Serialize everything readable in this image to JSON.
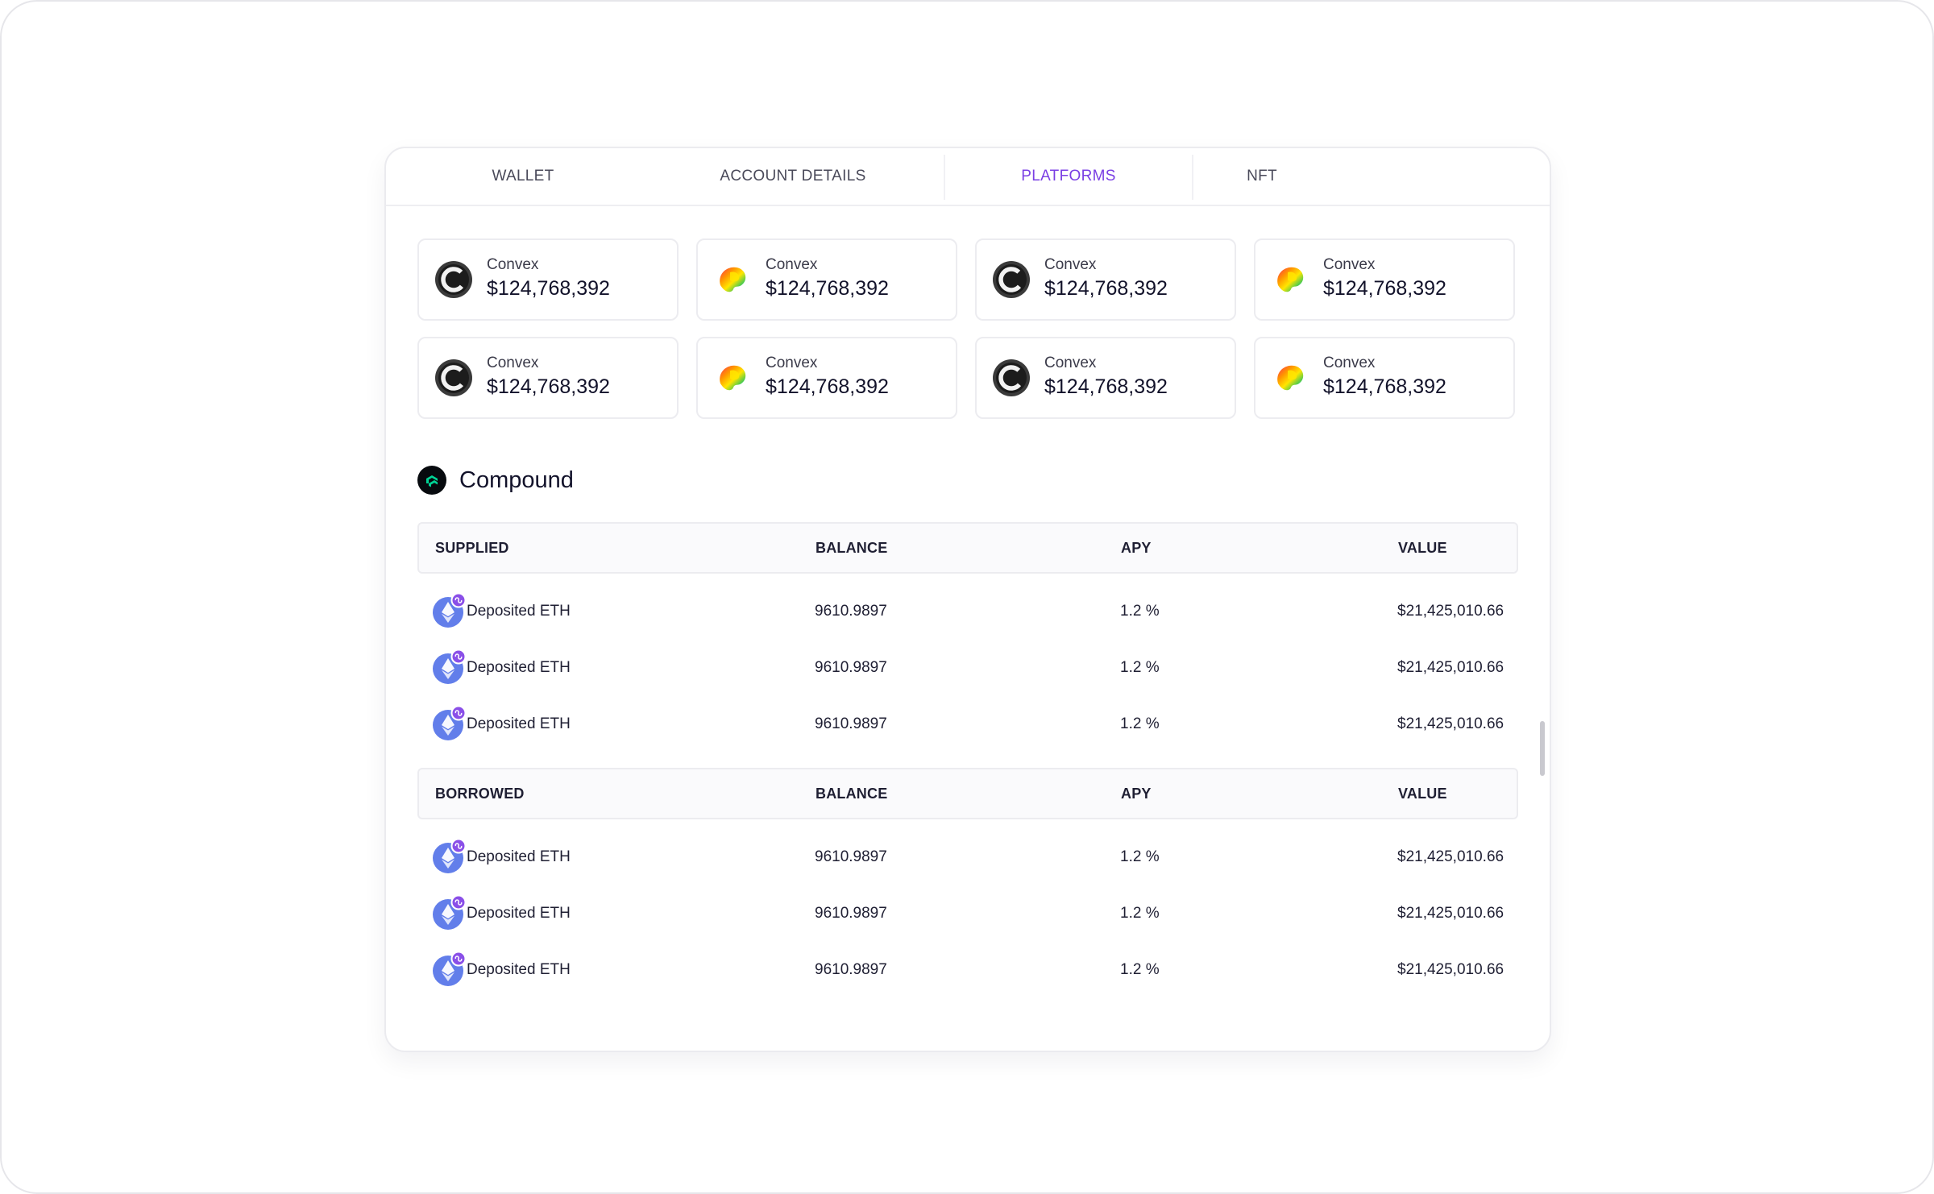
{
  "tabs": [
    {
      "label": "WALLET",
      "active": false
    },
    {
      "label": "ACCOUNT DETAILS",
      "active": false
    },
    {
      "label": "PLATFORMS",
      "active": true
    },
    {
      "label": "NFT",
      "active": false
    }
  ],
  "platforms": [
    {
      "icon": "convex-logo-icon",
      "name": "Convex",
      "value": "$124,768,392"
    },
    {
      "icon": "rainbow-logo-icon",
      "name": "Convex",
      "value": "$124,768,392"
    },
    {
      "icon": "convex-logo-icon",
      "name": "Convex",
      "value": "$124,768,392"
    },
    {
      "icon": "rainbow-logo-icon",
      "name": "Convex",
      "value": "$124,768,392"
    },
    {
      "icon": "convex-logo-icon",
      "name": "Convex",
      "value": "$124,768,392"
    },
    {
      "icon": "rainbow-logo-icon",
      "name": "Convex",
      "value": "$124,768,392"
    },
    {
      "icon": "convex-logo-icon",
      "name": "Convex",
      "value": "$124,768,392"
    },
    {
      "icon": "rainbow-logo-icon",
      "name": "Convex",
      "value": "$124,768,392"
    }
  ],
  "compound": {
    "title": "Compound",
    "icon": "compound-logo-icon",
    "supplied": {
      "headers": {
        "name": "SUPPLIED",
        "balance": "BALANCE",
        "apy": "APY",
        "value": "VALUE"
      },
      "rows": [
        {
          "asset": "Deposited ETH",
          "balance": "9610.9897",
          "apy": "1.2 %",
          "value": "$21,425,010.66"
        },
        {
          "asset": "Deposited ETH",
          "balance": "9610.9897",
          "apy": "1.2 %",
          "value": "$21,425,010.66"
        },
        {
          "asset": "Deposited ETH",
          "balance": "9610.9897",
          "apy": "1.2 %",
          "value": "$21,425,010.66"
        }
      ]
    },
    "borrowed": {
      "headers": {
        "name": "BORROWED",
        "balance": "BALANCE",
        "apy": "APY",
        "value": "VALUE"
      },
      "rows": [
        {
          "asset": "Deposited ETH",
          "balance": "9610.9897",
          "apy": "1.2 %",
          "value": "$21,425,010.66"
        },
        {
          "asset": "Deposited ETH",
          "balance": "9610.9897",
          "apy": "1.2 %",
          "value": "$21,425,010.66"
        },
        {
          "asset": "Deposited ETH",
          "balance": "9610.9897",
          "apy": "1.2 %",
          "value": "$21,425,010.66"
        }
      ]
    }
  },
  "colors": {
    "accent": "#7b3fe4",
    "eth": "#627eea",
    "eth_badge": "#8a4fe8",
    "compound": "#00d395"
  }
}
